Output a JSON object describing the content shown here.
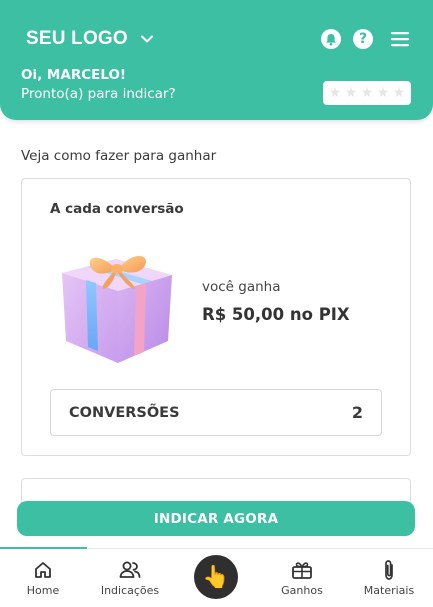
{
  "header": {
    "logo_text": "SEU LOGO",
    "greeting_name": "Oi, MARCELO!",
    "greeting_sub": "Pronto(a) para indicar?",
    "rating_stars": 5,
    "rating_filled": 0,
    "help_glyph": "?",
    "icons": [
      "chevron-down-icon",
      "bell-icon",
      "help-icon",
      "menu-icon"
    ]
  },
  "main": {
    "section_title": "Veja como fazer para ganhar",
    "card": {
      "title": "A cada conversão",
      "earn_label": "você ganha",
      "earn_value": "R$ 50,00 no PIX",
      "conversions_label": "CONVERSÕES",
      "conversions_count": "2"
    }
  },
  "cta": {
    "label": "INDICAR AGORA"
  },
  "bottom_nav": {
    "items": [
      {
        "label": "Home",
        "icon": "home-icon",
        "active": true
      },
      {
        "label": "Indicações",
        "icon": "users-icon"
      },
      {
        "label": "",
        "icon": "pointing-hand-icon",
        "center": true
      },
      {
        "label": "Ganhos",
        "icon": "gift-icon"
      },
      {
        "label": "Materiais",
        "icon": "paperclip-icon"
      }
    ]
  },
  "colors": {
    "brand": "#3dbfa4",
    "text": "#333333",
    "border": "#dddddd"
  }
}
